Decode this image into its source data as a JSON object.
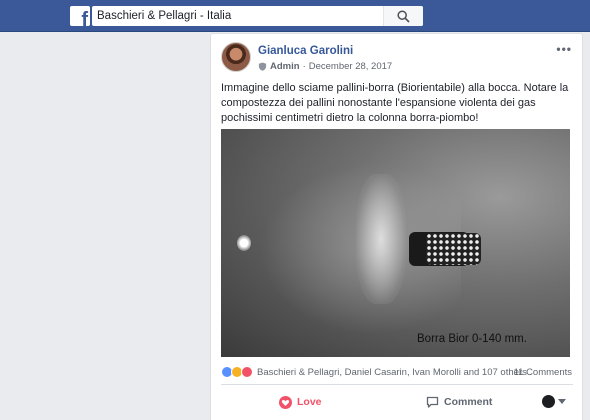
{
  "header": {
    "logo": "f",
    "search_value": "Baschieri & Pellagri - Italia",
    "search_icon": "search-icon"
  },
  "post": {
    "author": "Gianluca Garolini",
    "role": "Admin",
    "separator": "·",
    "date": "December 28, 2017",
    "more": "•••",
    "text": "Immagine dello sciame pallini-borra (Biorientabile) alla bocca. Notare la compostezza dei pallini nonostante l'espansione violenta dei gas pochissimi centimetri dietro la colonna borra-piombo!",
    "photo_caption": "Borra Bior  0-140 mm.",
    "reactions_text": "Baschieri & Pellagri, Daniel Casarin, Ivan Morolli and 107 others",
    "comments_count": "11 Comments"
  },
  "actions": {
    "love_label": "Love",
    "comment_label": "Comment"
  },
  "colors": {
    "brand": "#3b5998",
    "link": "#365899",
    "love": "#f25268",
    "like": "#5890ff",
    "wow": "#f7b125"
  }
}
